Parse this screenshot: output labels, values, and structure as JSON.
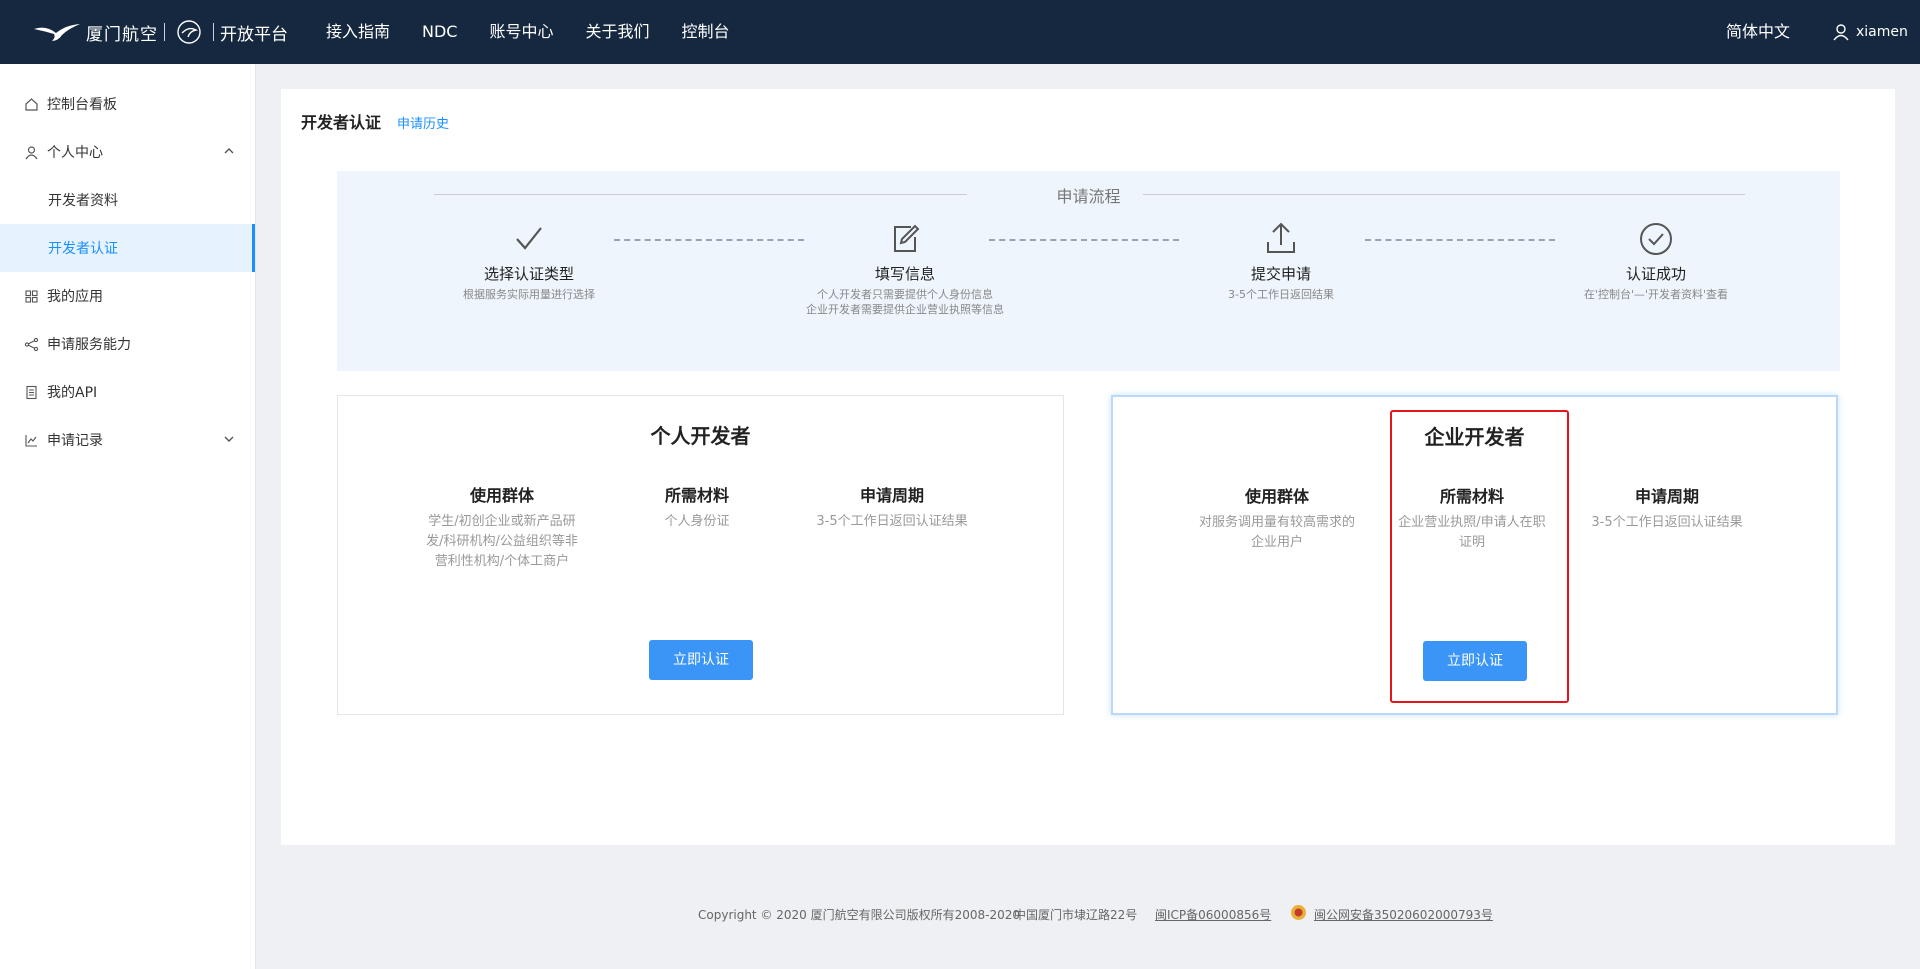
{
  "header": {
    "brand": "厦门航空",
    "platform": "开放平台",
    "nav": [
      "接入指南",
      "NDC",
      "账号中心",
      "关于我们",
      "控制台"
    ],
    "language": "简体中文",
    "username": "xiamen"
  },
  "sidebar": {
    "items": [
      {
        "label": "控制台看板",
        "icon": "home-icon"
      },
      {
        "label": "个人中心",
        "icon": "user-icon"
      },
      {
        "label": "开发者资料"
      },
      {
        "label": "开发者认证",
        "active": true
      },
      {
        "label": "我的应用",
        "icon": "apps-icon"
      },
      {
        "label": "申请服务能力",
        "icon": "share-icon"
      },
      {
        "label": "我的API",
        "icon": "api-doc-icon"
      },
      {
        "label": "申请记录",
        "icon": "chart-icon"
      }
    ]
  },
  "page": {
    "title": "开发者认证",
    "history_link": "申请历史"
  },
  "flow": {
    "title": "申请流程",
    "steps": [
      {
        "name": "选择认证类型",
        "desc1": "根据服务实际用量进行选择",
        "desc2": "",
        "icon": "check-icon"
      },
      {
        "name": "填写信息",
        "desc1": "个人开发者只需要提供个人身份信息",
        "desc2": "企业开发者需要提供企业营业执照等信息",
        "icon": "edit-icon"
      },
      {
        "name": "提交申请",
        "desc1": "3-5个工作日返回结果",
        "desc2": "",
        "icon": "upload-icon"
      },
      {
        "name": "认证成功",
        "desc1": "在'控制台'—'开发者资料'查看",
        "desc2": "",
        "icon": "check-circle-icon"
      }
    ]
  },
  "personal": {
    "title": "个人开发者",
    "cols": [
      {
        "head": "使用群体",
        "value": "学生/初创企业或新产品研发/科研机构/公益组织等非营利性机构/个体工商户"
      },
      {
        "head": "所需材料",
        "value": "个人身份证"
      },
      {
        "head": "申请周期",
        "value": "3-5个工作日返回认证结果"
      }
    ],
    "button": "立即认证"
  },
  "enterprise": {
    "title": "企业开发者",
    "cols": [
      {
        "head": "使用群体",
        "value": "对服务调用量有较高需求的企业用户"
      },
      {
        "head": "所需材料",
        "value": "企业营业执照/申请人在职证明"
      },
      {
        "head": "申请周期",
        "value": "3-5个工作日返回认证结果"
      }
    ],
    "button": "立即认证"
  },
  "footer": {
    "copyright": "Copyright © 2020 厦门航空有限公司版权所有2008-2020",
    "address": "中国厦门市埭辽路22号",
    "icp": "闽ICP备06000856号",
    "police": "闽公网安备35020602000793号"
  },
  "colors": {
    "topbar": "#16283f",
    "accent": "#1890ff",
    "button": "#3a95f7",
    "highlight_box": "#e5161b"
  }
}
